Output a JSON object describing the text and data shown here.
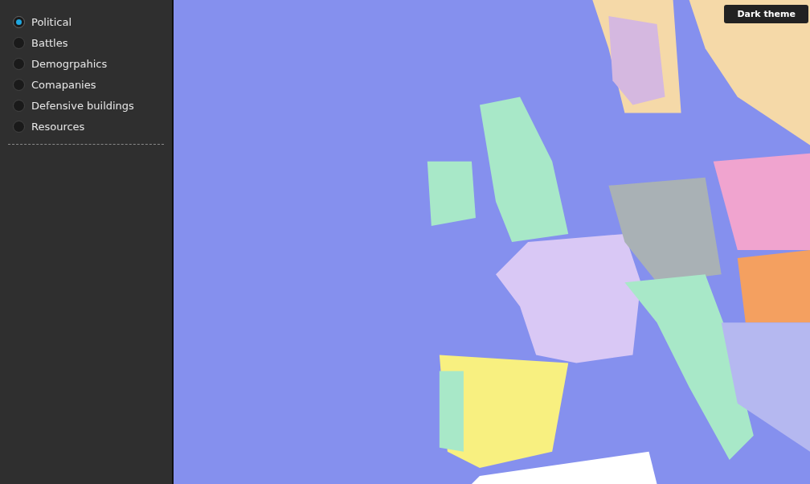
{
  "sidebar": {
    "layers": [
      {
        "label": "Political",
        "selected": true
      },
      {
        "label": "Battles",
        "selected": false
      },
      {
        "label": "Demogrpahics",
        "selected": false
      },
      {
        "label": "Comapanies",
        "selected": false
      },
      {
        "label": "Defensive buildings",
        "selected": false
      },
      {
        "label": "Resources",
        "selected": false
      }
    ]
  },
  "theme_button": {
    "label": "Dark theme"
  }
}
